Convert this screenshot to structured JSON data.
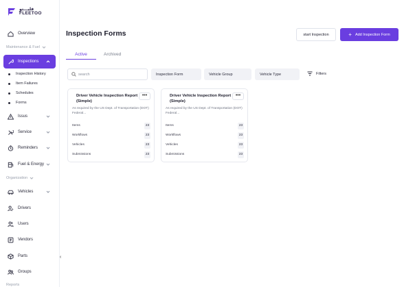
{
  "brand": {
    "arabic": "فليـــتو",
    "name": "FLEETOO",
    "accent": "#6a3ee0"
  },
  "sidebar": {
    "items": [
      {
        "label": "Overview",
        "icon": "home-icon"
      },
      {
        "section": "Maintenance & Fuel"
      },
      {
        "label": "Inspections",
        "icon": "wrench-icon",
        "active": true
      },
      {
        "label": "Inspection History"
      },
      {
        "label": "Item Failures"
      },
      {
        "label": "Schedules"
      },
      {
        "label": "Forms"
      },
      {
        "label": "Issus",
        "icon": "warning-icon"
      },
      {
        "label": "Service",
        "icon": "tools-icon"
      },
      {
        "label": "Reminders",
        "icon": "timer-icon"
      },
      {
        "label": "Fuel & Energy",
        "icon": "fuel-icon"
      },
      {
        "section": "Organization"
      },
      {
        "label": "Vehicles",
        "icon": "car-icon"
      },
      {
        "label": "Drivers",
        "icon": "driver-icon"
      },
      {
        "label": "Users",
        "icon": "users-icon"
      },
      {
        "label": "Vendors",
        "icon": "vendor-icon"
      },
      {
        "label": "Parts",
        "icon": "parts-icon"
      },
      {
        "label": "Groups",
        "icon": "groups-icon"
      },
      {
        "section": "Reports"
      }
    ]
  },
  "header": {
    "title": "Inspection Forms",
    "start_label": "start Inspection",
    "add_label": "Add Inspection Form"
  },
  "tabs": {
    "active": "Active",
    "archived": "Archived"
  },
  "toolbar": {
    "search_placeholder": "search",
    "filters": [
      "Inspection Form",
      "Vehicle Group",
      "Vehicle Type"
    ],
    "filters_label": "Filters"
  },
  "cards": [
    {
      "title": "Driver Vehicle Inspection Report (Simple)",
      "description": "As required by the US Dept. of Transportation (DOT) Federal...",
      "menu": "•••",
      "rows": [
        {
          "label": "Items",
          "value": "23"
        },
        {
          "label": "Workflows",
          "value": "23"
        },
        {
          "label": "Vehicles",
          "value": "23"
        },
        {
          "label": "Submissions",
          "value": "23"
        }
      ]
    },
    {
      "title": "Driver Vehicle Inspection Report (Simple)",
      "description": "As required by the US Dept. of Transportation (DOT) Federal...",
      "menu": "•••",
      "rows": [
        {
          "label": "Items",
          "value": "23"
        },
        {
          "label": "Workflows",
          "value": "23"
        },
        {
          "label": "Vehicles",
          "value": "23"
        },
        {
          "label": "Submissions",
          "value": "23"
        }
      ]
    }
  ],
  "collapse_glyph": "‹"
}
